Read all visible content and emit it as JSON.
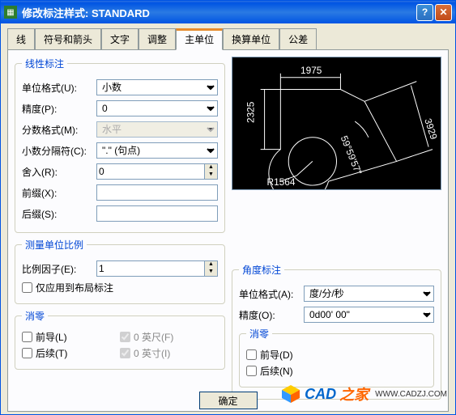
{
  "window": {
    "title": "修改标注样式: STANDARD"
  },
  "tabs": {
    "items": [
      {
        "label": "线"
      },
      {
        "label": "符号和箭头"
      },
      {
        "label": "文字"
      },
      {
        "label": "调整"
      },
      {
        "label": "主单位"
      },
      {
        "label": "换算单位"
      },
      {
        "label": "公差"
      }
    ],
    "active": 4
  },
  "linear": {
    "legend": "线性标注",
    "unit_format_label": "单位格式(U):",
    "unit_format_value": "小数",
    "precision_label": "精度(P):",
    "precision_value": "0",
    "fraction_format_label": "分数格式(M):",
    "fraction_format_value": "水平",
    "decimal_sep_label": "小数分隔符(C):",
    "decimal_sep_value": "\".\" (句点)",
    "round_label": "舍入(R):",
    "round_value": "0",
    "prefix_label": "前缀(X):",
    "prefix_value": "",
    "suffix_label": "后缀(S):",
    "suffix_value": ""
  },
  "scale": {
    "legend": "测量单位比例",
    "factor_label": "比例因子(E):",
    "factor_value": "1",
    "layout_only_label": "仅应用到布局标注"
  },
  "suppress": {
    "legend": "消零",
    "leading_label": "前导(L)",
    "trailing_label": "后续(T)",
    "feet_label": "0 英尺(F)",
    "inches_label": "0 英寸(I)"
  },
  "preview": {
    "d1": "1975",
    "d2": "2325",
    "d3": "3929",
    "d4": "R1564",
    "d5": "59°59'57\""
  },
  "angular": {
    "legend": "角度标注",
    "unit_format_label": "单位格式(A):",
    "unit_format_value": "度/分/秒",
    "precision_label": "精度(O):",
    "precision_value": "0d00' 00\"",
    "suppress_legend": "消零",
    "leading_label": "前导(D)",
    "trailing_label": "后续(N)"
  },
  "footer": {
    "ok": "确定"
  },
  "logo": {
    "t1": "CAD",
    "t2": "之家",
    "url": "WWW.CADZJ.COM"
  }
}
